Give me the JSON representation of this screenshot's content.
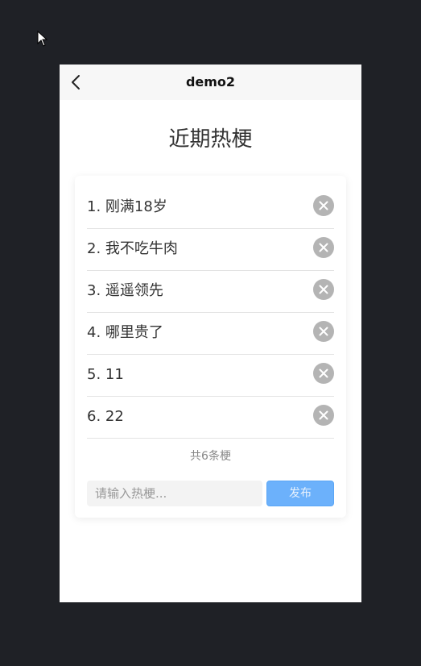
{
  "nav": {
    "title": "demo2",
    "back_icon": "chevron-left-icon"
  },
  "page": {
    "title": "近期热梗"
  },
  "list": {
    "items": [
      {
        "index": 1,
        "text": "1. 刚满18岁"
      },
      {
        "index": 2,
        "text": "2. 我不吃牛肉"
      },
      {
        "index": 3,
        "text": "3. 遥遥领先"
      },
      {
        "index": 4,
        "text": "4. 哪里贵了"
      },
      {
        "index": 5,
        "text": "5. 11"
      },
      {
        "index": 6,
        "text": "6. 22"
      }
    ],
    "delete_icon": "close-circle-icon",
    "count_text": "共6条梗"
  },
  "form": {
    "input_value": "",
    "input_placeholder": "请输入热梗...",
    "publish_label": "发布"
  },
  "colors": {
    "background": "#1f2126",
    "navbar": "#f7f7f7",
    "delete_icon": "#b4b4b4",
    "publish_button": "#6cb1fb"
  }
}
